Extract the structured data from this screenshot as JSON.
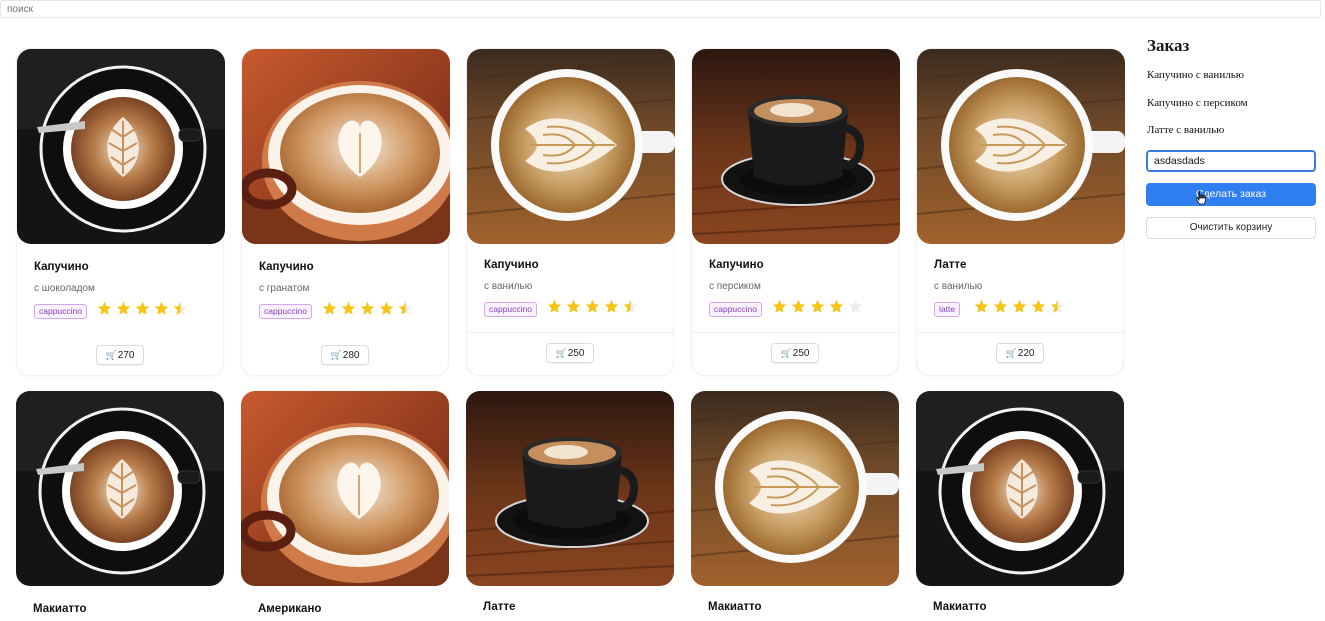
{
  "search": {
    "placeholder": "поиск"
  },
  "cards_row1": [
    {
      "title": "Капучино",
      "subtitle": "с шоколадом",
      "tag": "cappuccino",
      "rating": 4.5,
      "price": "270",
      "photo": "dark-top-view"
    },
    {
      "title": "Капучино",
      "subtitle": "с гранатом",
      "tag": "cappuccino",
      "rating": 4.5,
      "price": "280",
      "photo": "red-closeup"
    },
    {
      "title": "Капучино",
      "subtitle": "с ванилью",
      "tag": "cappuccino",
      "rating": 4.5,
      "price": "250",
      "photo": "wood-top-view"
    },
    {
      "title": "Капучино",
      "subtitle": "с персиком",
      "tag": "cappuccino",
      "rating": 4,
      "price": "250",
      "photo": "black-cup-side"
    },
    {
      "title": "Латте",
      "subtitle": "с ванилью",
      "tag": "latte",
      "rating": 4.5,
      "price": "220",
      "photo": "wood-top-view"
    }
  ],
  "cards_row2": [
    {
      "title": "Макиатто",
      "photo": "dark-top-view"
    },
    {
      "title": "Американо",
      "photo": "red-closeup"
    },
    {
      "title": "Латте",
      "photo": "black-cup-side"
    },
    {
      "title": "Макиатто",
      "photo": "wood-top-view"
    },
    {
      "title": "Макиатто",
      "photo": "dark-top-view"
    }
  ],
  "order": {
    "title": "Заказ",
    "items": [
      "Капучино с ванилью",
      "Капучино с персиком",
      "Латте с ванилью"
    ],
    "input_value": "asdasdads",
    "submit_label": "Сделать заказ",
    "clear_label": "Очистить корзину"
  },
  "colors": {
    "accent": "#2f7ff0",
    "star": "#f5c518",
    "tag": "#8a3fb8"
  },
  "icons": {
    "price": "cart-icon",
    "rating": "star-icon"
  }
}
